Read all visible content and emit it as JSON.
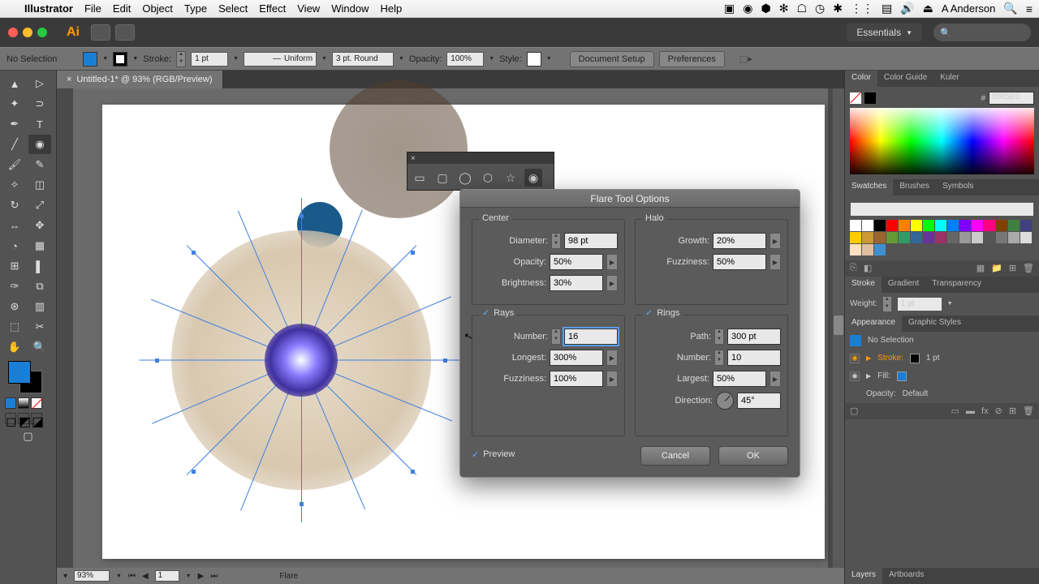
{
  "menubar": {
    "app": "Illustrator",
    "items": [
      "File",
      "Edit",
      "Object",
      "Type",
      "Select",
      "Effect",
      "View",
      "Window",
      "Help"
    ],
    "user": "A Anderson"
  },
  "workspace": {
    "name": "Essentials"
  },
  "controlbar": {
    "selection": "No Selection",
    "stroke_label": "Stroke:",
    "stroke_weight": "1 pt",
    "stroke_profile": "Uniform",
    "brush": "3 pt. Round",
    "opacity_label": "Opacity:",
    "opacity": "100%",
    "style_label": "Style:",
    "doc_setup": "Document Setup",
    "prefs": "Preferences"
  },
  "document": {
    "tab": "Untitled-1* @ 93% (RGB/Preview)"
  },
  "status": {
    "zoom": "93%",
    "page": "1",
    "tool": "Flare"
  },
  "dialog": {
    "title": "Flare Tool Options",
    "center": {
      "legend": "Center",
      "diameter_label": "Diameter:",
      "diameter": "98 pt",
      "opacity_label": "Opacity:",
      "opacity": "50%",
      "brightness_label": "Brightness:",
      "brightness": "30%"
    },
    "halo": {
      "legend": "Halo",
      "growth_label": "Growth:",
      "growth": "20%",
      "fuzziness_label": "Fuzziness:",
      "fuzziness": "50%"
    },
    "rays": {
      "enabled": true,
      "legend": "Rays",
      "number_label": "Number:",
      "number": "16",
      "longest_label": "Longest:",
      "longest": "300%",
      "fuzziness_label": "Fuzziness:",
      "fuzziness": "100%"
    },
    "rings": {
      "enabled": true,
      "legend": "Rings",
      "path_label": "Path:",
      "path": "300 pt",
      "number_label": "Number:",
      "number": "10",
      "largest_label": "Largest:",
      "largest": "50%",
      "direction_label": "Direction:",
      "direction": "45°"
    },
    "preview_label": "Preview",
    "preview": true,
    "cancel": "Cancel",
    "ok": "OK"
  },
  "panels": {
    "color": {
      "tabs": [
        "Color",
        "Color Guide",
        "Kuler"
      ],
      "hex": "0085E0"
    },
    "swatches": {
      "tabs": [
        "Swatches",
        "Brushes",
        "Symbols"
      ]
    },
    "stroke": {
      "tabs": [
        "Stroke",
        "Gradient",
        "Transparency"
      ],
      "weight_label": "Weight:",
      "weight": "1 pt"
    },
    "appearance": {
      "tabs": [
        "Appearance",
        "Graphic Styles"
      ],
      "selection": "No Selection",
      "stroke_label": "Stroke:",
      "stroke_val": "1 pt",
      "fill_label": "Fill:",
      "opacity_label": "Opacity:",
      "opacity_val": "Default"
    },
    "layers": {
      "tabs": [
        "Layers",
        "Artboards"
      ]
    }
  },
  "shape_tools": [
    "rectangle",
    "rounded-rectangle",
    "ellipse",
    "polygon",
    "star",
    "flare"
  ]
}
